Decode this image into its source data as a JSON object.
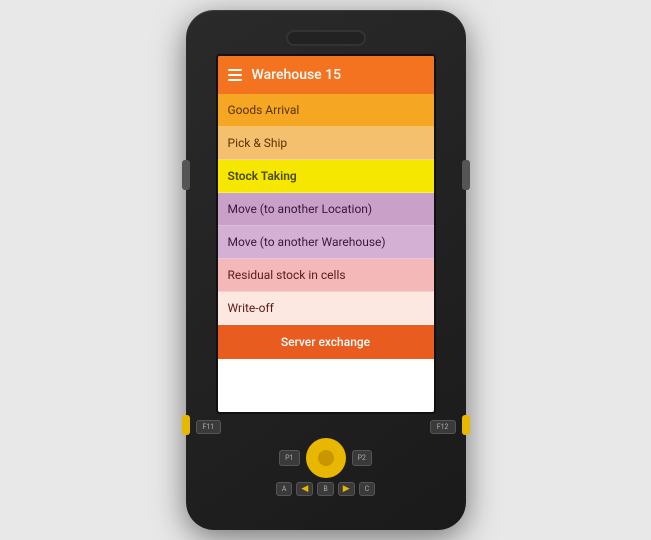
{
  "device": {
    "screen": {
      "header": {
        "title": "Warehouse 15",
        "menu_icon": "hamburger"
      },
      "menu_items": [
        {
          "label": "Goods Arrival",
          "style": "goods-arrival"
        },
        {
          "label": "Pick & Ship",
          "style": "pick-ship"
        },
        {
          "label": "Stock Taking",
          "style": "stock-taking"
        },
        {
          "label": "Move (to another Location)",
          "style": "move-location"
        },
        {
          "label": "Move (to another Warehouse)",
          "style": "move-warehouse"
        },
        {
          "label": "Residual stock in cells",
          "style": "residual"
        },
        {
          "label": "Write-off",
          "style": "writeoff"
        }
      ],
      "server_btn": "Server exchange"
    },
    "keypad": {
      "fn_left": "F11",
      "fn_right": "F12",
      "p1": "P1",
      "p2": "P2",
      "alpha_keys": [
        "A",
        "B",
        "C"
      ]
    }
  }
}
